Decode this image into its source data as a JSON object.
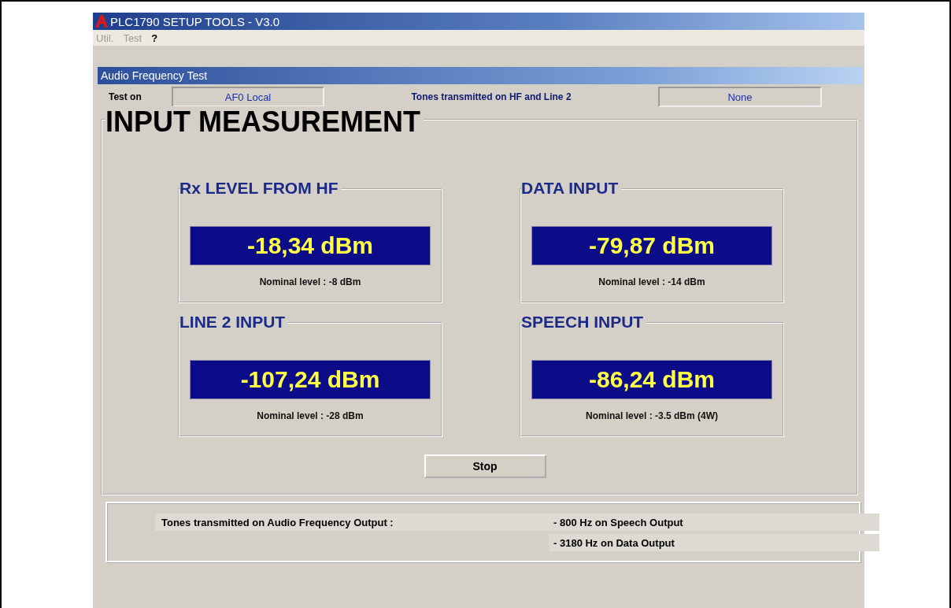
{
  "window": {
    "title": "PLC1790 SETUP TOOLS  -  V3.0"
  },
  "menu": [
    {
      "label": "Util.",
      "disabled": true
    },
    {
      "label": "Test",
      "disabled": true
    },
    {
      "label": "?",
      "disabled": false
    }
  ],
  "subwindow": {
    "title": "Audio Frequency Test"
  },
  "test_bar": {
    "label": "Test on",
    "value": "AF0 Local",
    "tones_label": "Tones transmitted on HF and Line 2",
    "tones_value": "None"
  },
  "measurement": {
    "title": "INPUT MEASUREMENT",
    "inputs": [
      {
        "title": "Rx LEVEL FROM HF",
        "reading": "-18,34 dBm",
        "nominal": "Nominal level : -8 dBm"
      },
      {
        "title": "DATA INPUT",
        "reading": "-79,87 dBm",
        "nominal": "Nominal level : -14 dBm"
      },
      {
        "title": "LINE 2 INPUT",
        "reading": "-107,24 dBm",
        "nominal": "Nominal level : -28 dBm"
      },
      {
        "title": "SPEECH INPUT",
        "reading": "-86,24 dBm",
        "nominal": "Nominal level : -3.5 dBm (4W)"
      }
    ],
    "button": "Stop"
  },
  "output": {
    "label": "Tones transmitted on Audio Frequency Output :",
    "tones": [
      "- 800 Hz on Speech Output",
      "- 3180 Hz on Data Output"
    ]
  }
}
